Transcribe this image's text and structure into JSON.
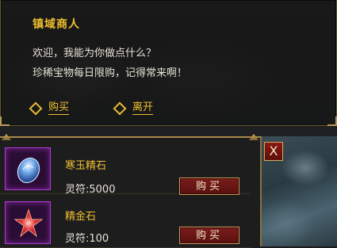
{
  "npc": {
    "name": "镇域商人",
    "greeting": "欢迎，我能为你做点什么？",
    "message": "珍稀宝物每日限购，记得常来啊！",
    "options": [
      {
        "label": "购买",
        "icon": "diamond-icon"
      },
      {
        "label": "离开",
        "icon": "diamond-icon"
      }
    ]
  },
  "shop": {
    "close_label": "X",
    "items": [
      {
        "name": "寒玉精石",
        "price": "灵符:5000",
        "buy_label": "购买",
        "icon": "blue-jade-stone-icon"
      },
      {
        "name": "精金石",
        "price": "灵符:100",
        "buy_label": "购买",
        "icon": "red-star-stone-icon"
      }
    ]
  },
  "colors": {
    "gold": "#f0c030",
    "frame": "#a88a4c",
    "button_red": "#7a1c1c",
    "slot_purple": "#b03ad2"
  }
}
